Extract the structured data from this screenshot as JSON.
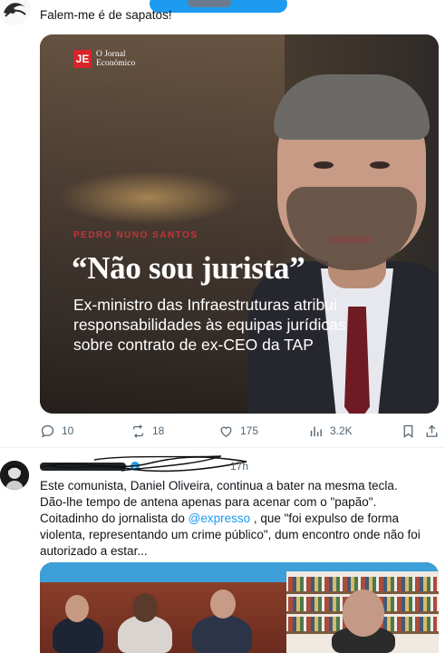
{
  "tweet1": {
    "text": "Falem-me é de sapatos!",
    "media": {
      "logo_mark": "JE",
      "logo_line1": "O Jornal",
      "logo_line2": "Económico",
      "kicker": "PEDRO NUNO SANTOS",
      "headline": "“Não sou jurista”",
      "subtitle": "Ex-ministro das Infraestruturas atribui responsabilidades às equipas jurídicas sobre contrato de ex-CEO da TAP"
    },
    "actions": {
      "replies": "10",
      "reposts": "18",
      "likes": "175",
      "views": "3.2K"
    }
  },
  "tweet2": {
    "meta": "17h",
    "text_line1": "Este comunista, Daniel Oliveira, continua a bater na mesma tecla.",
    "text_line2": "Dão-lhe tempo de antena apenas para acenar com o \"papão\".",
    "text_line3_pre": "Coitadinho do jornalista do ",
    "mention": "@expresso",
    "text_line3_post": " , que \"foi expulso de forma violenta, representando um crime público\", dum encontro onde não foi autorizado a estar..."
  },
  "colors": {
    "accent": "#1d9bf0",
    "secondary_text": "#536471",
    "kicker_red": "#c8333a",
    "brand_red": "#d8232a"
  },
  "icons": [
    "reply-icon",
    "repost-icon",
    "like-icon",
    "views-icon",
    "bookmark-icon",
    "share-icon",
    "verified-badge-icon"
  ]
}
